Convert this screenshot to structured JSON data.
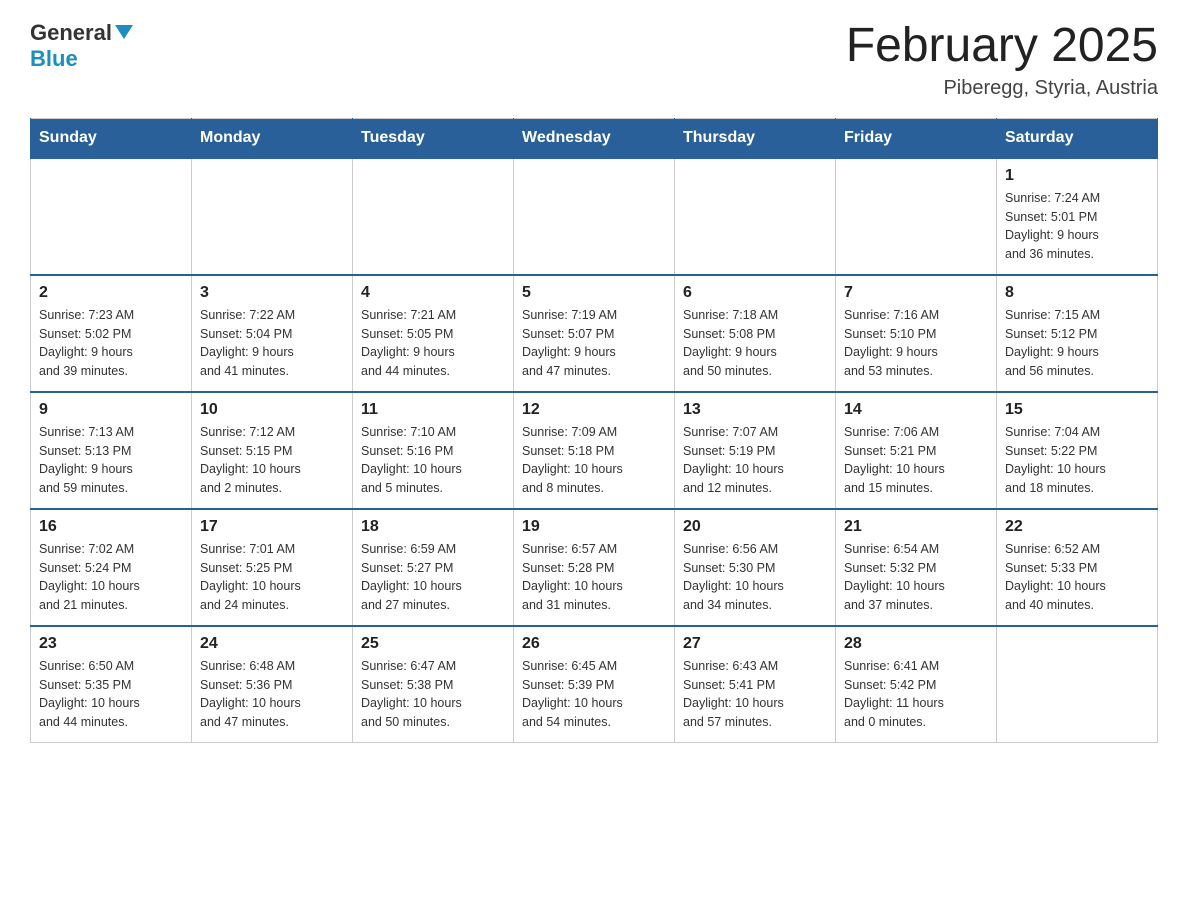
{
  "header": {
    "logo": {
      "general": "General",
      "triangle": "▶",
      "blue": "Blue"
    },
    "title": "February 2025",
    "location": "Piberegg, Styria, Austria"
  },
  "days_of_week": [
    "Sunday",
    "Monday",
    "Tuesday",
    "Wednesday",
    "Thursday",
    "Friday",
    "Saturday"
  ],
  "weeks": [
    {
      "days": [
        {
          "number": "",
          "info": ""
        },
        {
          "number": "",
          "info": ""
        },
        {
          "number": "",
          "info": ""
        },
        {
          "number": "",
          "info": ""
        },
        {
          "number": "",
          "info": ""
        },
        {
          "number": "",
          "info": ""
        },
        {
          "number": "1",
          "info": "Sunrise: 7:24 AM\nSunset: 5:01 PM\nDaylight: 9 hours\nand 36 minutes."
        }
      ]
    },
    {
      "days": [
        {
          "number": "2",
          "info": "Sunrise: 7:23 AM\nSunset: 5:02 PM\nDaylight: 9 hours\nand 39 minutes."
        },
        {
          "number": "3",
          "info": "Sunrise: 7:22 AM\nSunset: 5:04 PM\nDaylight: 9 hours\nand 41 minutes."
        },
        {
          "number": "4",
          "info": "Sunrise: 7:21 AM\nSunset: 5:05 PM\nDaylight: 9 hours\nand 44 minutes."
        },
        {
          "number": "5",
          "info": "Sunrise: 7:19 AM\nSunset: 5:07 PM\nDaylight: 9 hours\nand 47 minutes."
        },
        {
          "number": "6",
          "info": "Sunrise: 7:18 AM\nSunset: 5:08 PM\nDaylight: 9 hours\nand 50 minutes."
        },
        {
          "number": "7",
          "info": "Sunrise: 7:16 AM\nSunset: 5:10 PM\nDaylight: 9 hours\nand 53 minutes."
        },
        {
          "number": "8",
          "info": "Sunrise: 7:15 AM\nSunset: 5:12 PM\nDaylight: 9 hours\nand 56 minutes."
        }
      ]
    },
    {
      "days": [
        {
          "number": "9",
          "info": "Sunrise: 7:13 AM\nSunset: 5:13 PM\nDaylight: 9 hours\nand 59 minutes."
        },
        {
          "number": "10",
          "info": "Sunrise: 7:12 AM\nSunset: 5:15 PM\nDaylight: 10 hours\nand 2 minutes."
        },
        {
          "number": "11",
          "info": "Sunrise: 7:10 AM\nSunset: 5:16 PM\nDaylight: 10 hours\nand 5 minutes."
        },
        {
          "number": "12",
          "info": "Sunrise: 7:09 AM\nSunset: 5:18 PM\nDaylight: 10 hours\nand 8 minutes."
        },
        {
          "number": "13",
          "info": "Sunrise: 7:07 AM\nSunset: 5:19 PM\nDaylight: 10 hours\nand 12 minutes."
        },
        {
          "number": "14",
          "info": "Sunrise: 7:06 AM\nSunset: 5:21 PM\nDaylight: 10 hours\nand 15 minutes."
        },
        {
          "number": "15",
          "info": "Sunrise: 7:04 AM\nSunset: 5:22 PM\nDaylight: 10 hours\nand 18 minutes."
        }
      ]
    },
    {
      "days": [
        {
          "number": "16",
          "info": "Sunrise: 7:02 AM\nSunset: 5:24 PM\nDaylight: 10 hours\nand 21 minutes."
        },
        {
          "number": "17",
          "info": "Sunrise: 7:01 AM\nSunset: 5:25 PM\nDaylight: 10 hours\nand 24 minutes."
        },
        {
          "number": "18",
          "info": "Sunrise: 6:59 AM\nSunset: 5:27 PM\nDaylight: 10 hours\nand 27 minutes."
        },
        {
          "number": "19",
          "info": "Sunrise: 6:57 AM\nSunset: 5:28 PM\nDaylight: 10 hours\nand 31 minutes."
        },
        {
          "number": "20",
          "info": "Sunrise: 6:56 AM\nSunset: 5:30 PM\nDaylight: 10 hours\nand 34 minutes."
        },
        {
          "number": "21",
          "info": "Sunrise: 6:54 AM\nSunset: 5:32 PM\nDaylight: 10 hours\nand 37 minutes."
        },
        {
          "number": "22",
          "info": "Sunrise: 6:52 AM\nSunset: 5:33 PM\nDaylight: 10 hours\nand 40 minutes."
        }
      ]
    },
    {
      "days": [
        {
          "number": "23",
          "info": "Sunrise: 6:50 AM\nSunset: 5:35 PM\nDaylight: 10 hours\nand 44 minutes."
        },
        {
          "number": "24",
          "info": "Sunrise: 6:48 AM\nSunset: 5:36 PM\nDaylight: 10 hours\nand 47 minutes."
        },
        {
          "number": "25",
          "info": "Sunrise: 6:47 AM\nSunset: 5:38 PM\nDaylight: 10 hours\nand 50 minutes."
        },
        {
          "number": "26",
          "info": "Sunrise: 6:45 AM\nSunset: 5:39 PM\nDaylight: 10 hours\nand 54 minutes."
        },
        {
          "number": "27",
          "info": "Sunrise: 6:43 AM\nSunset: 5:41 PM\nDaylight: 10 hours\nand 57 minutes."
        },
        {
          "number": "28",
          "info": "Sunrise: 6:41 AM\nSunset: 5:42 PM\nDaylight: 11 hours\nand 0 minutes."
        },
        {
          "number": "",
          "info": ""
        }
      ]
    }
  ]
}
